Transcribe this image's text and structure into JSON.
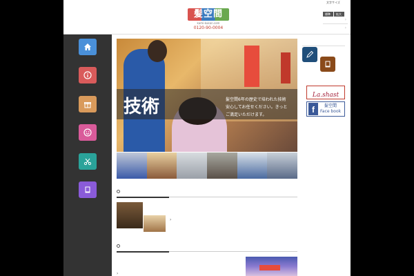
{
  "header": {
    "logo_text": "髪空間",
    "logo_url": "kami-kukan.com",
    "logo_phone": "0120-90-0004",
    "fontsize_label": "文字サイズ",
    "fontsize_standard": "標準",
    "fontsize_large": "拡大"
  },
  "leftnav": {
    "items": [
      {
        "icon": "home-icon",
        "color": "#4a90d9"
      },
      {
        "icon": "info-icon",
        "color": "#d95b5b"
      },
      {
        "icon": "gift-icon",
        "color": "#d99a5b"
      },
      {
        "icon": "smile-icon",
        "color": "#d95b9a"
      },
      {
        "icon": "scissors-icon",
        "color": "#2aa39a"
      },
      {
        "icon": "book-icon",
        "color": "#8a5bd9"
      }
    ]
  },
  "hero": {
    "title": "技術",
    "text_line1": "髪空間6年の歴史で培われた技術",
    "text_line2": "安心してお任せください。きっと",
    "text_line3": "ご満足いただけます。"
  },
  "rightcol": {
    "icons": [
      {
        "icon": "pencil-icon",
        "color": "#1f4e7a"
      },
      {
        "icon": "notebook-icon",
        "color": "#8a4a1a"
      }
    ],
    "banner1_text": "La.shast",
    "banner2_fb": "f",
    "banner2_line1": "髪空間",
    "banner2_line2": "Face book"
  },
  "colors": {
    "page_bg": "#000000",
    "sidebar_bg": "#333333",
    "accent": "#3a7bbf"
  }
}
